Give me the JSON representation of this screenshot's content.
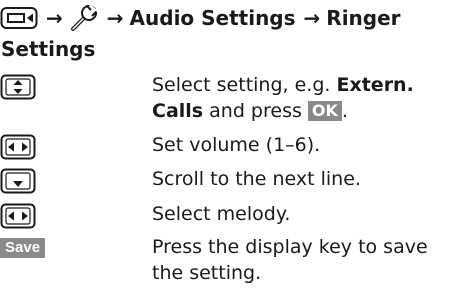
{
  "heading": {
    "path": [
      "Audio Settings",
      "Ringer"
    ],
    "path_line2": "Settings",
    "icons": [
      "menu-key-icon",
      "wrench-icon"
    ],
    "separator": "→"
  },
  "steps": [
    {
      "key_icon": "control-key-up-down-icon",
      "text_before": "Select setting, e.g. ",
      "text_bold": "Extern. Calls",
      "text_middle": " and press ",
      "display_key": "OK",
      "text_after": "."
    },
    {
      "key_icon": "control-key-left-right-icon",
      "text": "Set volume (1–6)."
    },
    {
      "key_icon": "control-key-down-icon",
      "text": "Scroll to the next line."
    },
    {
      "key_icon": "control-key-left-right-icon",
      "text": "Select melody."
    },
    {
      "display_key": "Save",
      "text": "Press the display key to save the setting."
    }
  ]
}
